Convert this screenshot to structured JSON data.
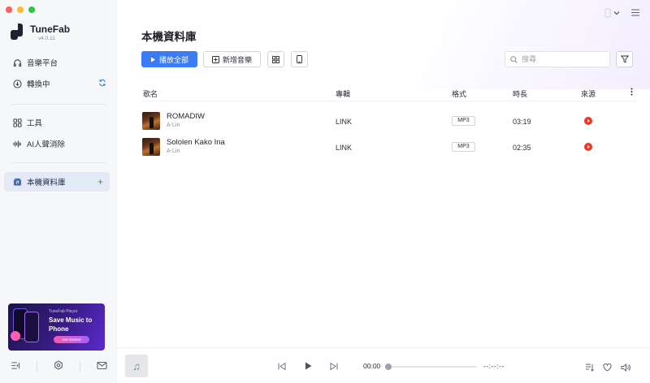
{
  "app": {
    "name": "TuneFab",
    "version": "v4.0.11"
  },
  "sidebar": {
    "items": [
      {
        "label": "音樂平台",
        "icon": "headphones-icon"
      },
      {
        "label": "轉換中",
        "icon": "download-circle-icon"
      },
      {
        "label": "工具",
        "icon": "grid-icon"
      },
      {
        "label": "AI人聲消除",
        "icon": "waveform-icon"
      },
      {
        "label": "本機資料庫",
        "icon": "library-icon"
      }
    ],
    "active": "本機資料庫"
  },
  "promo": {
    "kicker": "TuneFab Player",
    "headline": "Save Music to Phone",
    "button": "Get Started"
  },
  "main": {
    "title": "本機資料庫",
    "play_all": "播放全部",
    "add_music": "新增音樂",
    "search_placeholder": "搜尋"
  },
  "table": {
    "columns": [
      "歌名",
      "專輯",
      "格式",
      "時長",
      "來源"
    ],
    "rows": [
      {
        "title": "ROMADIW",
        "artist": "A-Lin",
        "album": "LINK",
        "format": "MP3",
        "duration": "03:19",
        "source": "youtube-music-icon"
      },
      {
        "title": "Sololen Kako Ina",
        "artist": "A-Lin",
        "album": "LINK",
        "format": "MP3",
        "duration": "02:35",
        "source": "youtube-music-icon"
      }
    ]
  },
  "player": {
    "current_time": "00:00",
    "total_time": "--:--:--",
    "progress": 0
  },
  "colors": {
    "accent": "#3b7bf4",
    "source_red": "#e8392c",
    "active_nav_bg": "#e3e9f5"
  }
}
